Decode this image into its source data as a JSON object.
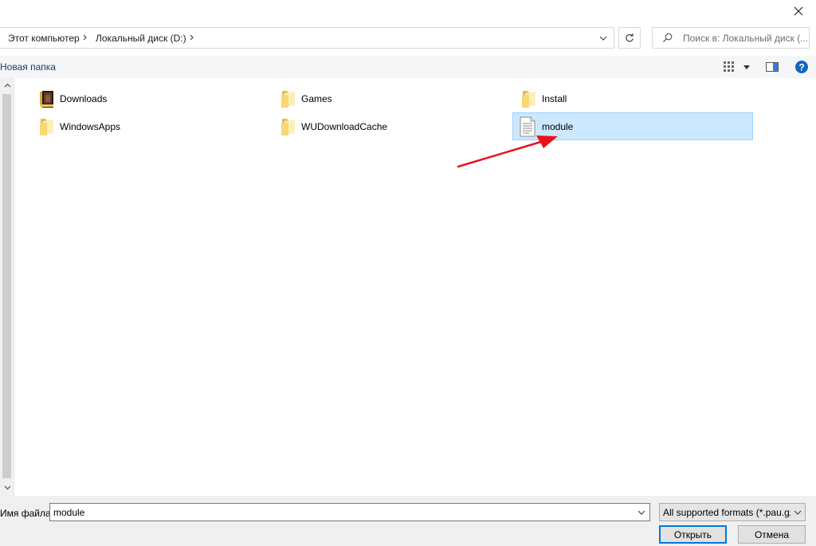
{
  "address": {
    "crumbs": [
      "Этот компьютер",
      "Локальный диск (D:)"
    ]
  },
  "search": {
    "placeholder": "Поиск в: Локальный диск (..."
  },
  "toolbar": {
    "new_folder_label": "Новая папка",
    "view_icon": "view-grid-icon",
    "preview_icon": "preview-pane-icon",
    "help_icon": "help-icon"
  },
  "files": [
    {
      "name": "Downloads",
      "icon": "downloads-folder-icon"
    },
    {
      "name": "Games",
      "icon": "folder-icon"
    },
    {
      "name": "Install",
      "icon": "folder-icon"
    },
    {
      "name": "WindowsApps",
      "icon": "folder-icon"
    },
    {
      "name": "WUDownloadCache",
      "icon": "folder-icon"
    },
    {
      "name": "module",
      "icon": "document-icon",
      "selected": true
    }
  ],
  "bottom": {
    "filename_label": "Имя файла:",
    "filename_value": "module",
    "filetype_selected": "All supported formats (*.pau.gz",
    "open_label": "Открыть",
    "cancel_label": "Отмена"
  },
  "colors": {
    "selection_bg": "#cce8ff",
    "selection_border": "#99d1ff",
    "accent": "#0078d7",
    "folder_yellow": "#f8d775",
    "arrow_red": "#e8141c"
  }
}
